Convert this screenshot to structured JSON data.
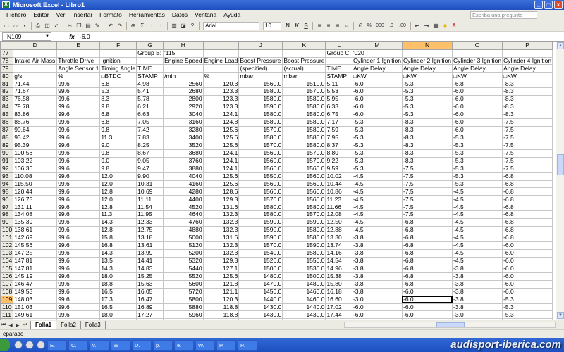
{
  "window": {
    "title": "Microsoft Excel - Libro1",
    "app_icon": "X"
  },
  "window_buttons": {
    "minimize": "_",
    "maximize": "□",
    "close": "x"
  },
  "menu": [
    "Fichero",
    "Editar",
    "Ver",
    "Insertar",
    "Formato",
    "Herramientas",
    "Datos",
    "Ventana",
    "Ayuda"
  ],
  "help_placeholder": "Escriba una pregunta",
  "toolbar": {
    "font": "Arial",
    "size": "10",
    "bold": "N",
    "italic": "K",
    "underline": "S",
    "currency": "€",
    "percent": "%",
    "thousands": "000",
    "dec_up": ",0",
    "dec_down": ",00"
  },
  "formula": {
    "cell": "N109",
    "fx": "fx",
    "value": "-6.0"
  },
  "columns": [
    "D",
    "E",
    "F",
    "G",
    "H",
    "I",
    "J",
    "K",
    "L",
    "M",
    "N",
    "O",
    "P"
  ],
  "header_rows": [
    {
      "row": "77",
      "cells": [
        "",
        "",
        "",
        "Group B:",
        "'115",
        "",
        "",
        "",
        "Group C:",
        "'020",
        "",
        "",
        ""
      ]
    },
    {
      "row": "78",
      "cells": [
        "Intake Air Mass",
        "Throttle Drive",
        "Ignition",
        "",
        "Engine Speed",
        "Engine Load",
        "Boost Pressure",
        "Boost Pressure",
        "",
        "Cylinder 1 Ignition",
        "Cylinder 2 Ignition",
        "Cylinder 3 Ignition",
        "Cylinder 4 Ignition"
      ]
    },
    {
      "row": "79",
      "cells": [
        "",
        "Angle Sensor 1",
        "Timing Angle",
        "TIME",
        "",
        "",
        "(specified)",
        "(actual)",
        "TIME",
        "Angle Delay",
        "Angle Delay",
        "Angle Delay",
        "Angle Delay"
      ]
    },
    {
      "row": "80",
      "cells": [
        "g/s",
        "%",
        "□BTDC",
        "STAMP",
        "/min",
        "%",
        "mbar",
        "mbar",
        "STAMP",
        "□KW",
        "□KW",
        "□KW",
        "□KW"
      ]
    }
  ],
  "data_rows": [
    {
      "row": "81",
      "cells": [
        "71.44",
        "99.6",
        "6.8",
        "4.98",
        "2560",
        "120.3",
        "1560.0",
        "1510.0",
        "5.11",
        "-6.0",
        "-5.3",
        "-6.8",
        "-8.3"
      ]
    },
    {
      "row": "82",
      "cells": [
        "71.67",
        "99.6",
        "5.3",
        "5.41",
        "2680",
        "123.3",
        "1580.0",
        "1570.0",
        "5.53",
        "-6.0",
        "-5.3",
        "-6.0",
        "-8.3"
      ]
    },
    {
      "row": "83",
      "cells": [
        "76.58",
        "99.6",
        "8.3",
        "5.78",
        "2800",
        "123.3",
        "1580.0",
        "1580.0",
        "5.95",
        "-6.0",
        "-5.3",
        "-6.0",
        "-8.3"
      ]
    },
    {
      "row": "84",
      "cells": [
        "79.78",
        "99.6",
        "9.8",
        "6.21",
        "2920",
        "123.3",
        "1590.0",
        "1580.0",
        "6.33",
        "-6.0",
        "-5.3",
        "-6.0",
        "-8.3"
      ]
    },
    {
      "row": "85",
      "cells": [
        "83.86",
        "99.6",
        "6.8",
        "6.63",
        "3040",
        "124.1",
        "1580.0",
        "1580.0",
        "6.75",
        "-6.0",
        "-5.3",
        "-6.0",
        "-8.3"
      ]
    },
    {
      "row": "86",
      "cells": [
        "88.76",
        "99.6",
        "6.8",
        "7.05",
        "3160",
        "124.8",
        "1580.0",
        "1580.0",
        "7.17",
        "-5.3",
        "-8.3",
        "-6.0",
        "-7.5"
      ]
    },
    {
      "row": "87",
      "cells": [
        "90.64",
        "99.6",
        "9.8",
        "7.42",
        "3280",
        "125.6",
        "1570.0",
        "1580.0",
        "7.59",
        "-5.3",
        "-8.3",
        "-6.0",
        "-7.5"
      ]
    },
    {
      "row": "88",
      "cells": [
        "93.42",
        "99.6",
        "11.3",
        "7.83",
        "3400",
        "125.6",
        "1580.0",
        "1580.0",
        "7.95",
        "-5.3",
        "-8.3",
        "-5.3",
        "-7.5"
      ]
    },
    {
      "row": "89",
      "cells": [
        "95.39",
        "99.6",
        "9.0",
        "8.25",
        "3520",
        "125.6",
        "1570.0",
        "1580.0",
        "8.37",
        "-5.3",
        "-8.3",
        "-5.3",
        "-7.5"
      ]
    },
    {
      "row": "90",
      "cells": [
        "100.56",
        "99.6",
        "9.8",
        "8.67",
        "3680",
        "124.1",
        "1560.0",
        "1570.0",
        "8.80",
        "-5.3",
        "-8.3",
        "-5.3",
        "-7.5"
      ]
    },
    {
      "row": "91",
      "cells": [
        "103.22",
        "99.6",
        "9.0",
        "9.05",
        "3760",
        "124.1",
        "1560.0",
        "1570.0",
        "9.22",
        "-5.3",
        "-8.3",
        "-5.3",
        "-7.5"
      ]
    },
    {
      "row": "92",
      "cells": [
        "106.36",
        "99.6",
        "9.8",
        "9.47",
        "3880",
        "124.1",
        "1560.0",
        "1560.0",
        "9.59",
        "-5.3",
        "-7.5",
        "-5.3",
        "-7.5"
      ]
    },
    {
      "row": "93",
      "cells": [
        "110.08",
        "99.6",
        "12.0",
        "9.90",
        "4040",
        "125.6",
        "1550.0",
        "1560.0",
        "10.02",
        "-4.5",
        "-7.5",
        "-5.3",
        "-6.8"
      ]
    },
    {
      "row": "94",
      "cells": [
        "115.50",
        "99.6",
        "12.0",
        "10.31",
        "4160",
        "125.6",
        "1560.0",
        "1560.0",
        "10.44",
        "-4.5",
        "-7.5",
        "-5.3",
        "-6.8"
      ]
    },
    {
      "row": "95",
      "cells": [
        "120.44",
        "99.6",
        "12.8",
        "10.69",
        "4280",
        "128.6",
        "1560.0",
        "1560.0",
        "10.86",
        "-4.5",
        "-7.5",
        "-4.5",
        "-6.8"
      ]
    },
    {
      "row": "96",
      "cells": [
        "126.75",
        "99.6",
        "12.0",
        "11.11",
        "4400",
        "129.3",
        "1570.0",
        "1560.0",
        "11.23",
        "-4.5",
        "-7.5",
        "-4.5",
        "-6.8"
      ]
    },
    {
      "row": "97",
      "cells": [
        "131.11",
        "99.6",
        "12.8",
        "11.54",
        "4520",
        "131.6",
        "1580.0",
        "1580.0",
        "11.66",
        "-4.5",
        "-7.5",
        "-4.5",
        "-6.8"
      ]
    },
    {
      "row": "98",
      "cells": [
        "134.08",
        "99.6",
        "11.3",
        "11.95",
        "4640",
        "132.3",
        "1580.0",
        "1570.0",
        "12.08",
        "-4.5",
        "-7.5",
        "-4.5",
        "-6.8"
      ]
    },
    {
      "row": "99",
      "cells": [
        "135.39",
        "99.6",
        "14.3",
        "12.33",
        "4760",
        "132.3",
        "1590.0",
        "1590.0",
        "12.50",
        "-4.5",
        "-6.8",
        "-4.5",
        "-6.8"
      ]
    },
    {
      "row": "100",
      "cells": [
        "138.61",
        "99.6",
        "12.8",
        "12.75",
        "4880",
        "132.3",
        "1590.0",
        "1580.0",
        "12.88",
        "-4.5",
        "-6.8",
        "-4.5",
        "-6.8"
      ]
    },
    {
      "row": "101",
      "cells": [
        "142.69",
        "99.6",
        "15.8",
        "13.18",
        "5000",
        "131.6",
        "1590.0",
        "1580.0",
        "13.30",
        "-3.8",
        "-6.8",
        "-4.5",
        "-6.8"
      ]
    },
    {
      "row": "102",
      "cells": [
        "145.56",
        "99.6",
        "16.8",
        "13.61",
        "5120",
        "132.3",
        "1570.0",
        "1590.0",
        "13.74",
        "-3.8",
        "-6.8",
        "-4.5",
        "-6.0"
      ]
    },
    {
      "row": "103",
      "cells": [
        "147.25",
        "99.6",
        "14.3",
        "13.99",
        "5200",
        "132.3",
        "1540.0",
        "1580.0",
        "14.16",
        "-3.8",
        "-6.8",
        "-4.5",
        "-6.0"
      ]
    },
    {
      "row": "104",
      "cells": [
        "147.81",
        "99.6",
        "13.5",
        "14.41",
        "5320",
        "129.3",
        "1520.0",
        "1550.0",
        "14.54",
        "-3.8",
        "-6.8",
        "-4.5",
        "-6.0"
      ]
    },
    {
      "row": "105",
      "cells": [
        "147.81",
        "99.6",
        "14.3",
        "14.83",
        "5440",
        "127.1",
        "1500.0",
        "1530.0",
        "14.96",
        "-3.8",
        "-6.8",
        "-3.8",
        "-6.0"
      ]
    },
    {
      "row": "106",
      "cells": [
        "145.19",
        "99.6",
        "18.0",
        "15.25",
        "5520",
        "125.6",
        "1480.0",
        "1500.0",
        "15.38",
        "-3.8",
        "-6.8",
        "-3.8",
        "-6.0"
      ]
    },
    {
      "row": "107",
      "cells": [
        "146.47",
        "99.6",
        "18.8",
        "15.63",
        "5600",
        "121.8",
        "1470.0",
        "1480.0",
        "15.80",
        "-3.8",
        "-6.8",
        "-3.8",
        "-6.0"
      ]
    },
    {
      "row": "108",
      "cells": [
        "149.53",
        "99.6",
        "16.5",
        "16.05",
        "5720",
        "121.1",
        "1450.0",
        "1460.0",
        "16.18",
        "-3.8",
        "-6.0",
        "-3.8",
        "-6.0"
      ]
    },
    {
      "row": "109",
      "cells": [
        "148.03",
        "99.6",
        "17.3",
        "16.47",
        "5800",
        "120.3",
        "1440.0",
        "1460.0",
        "16.60",
        "-3.0",
        "-6.0",
        "-3.8",
        "-5.3"
      ]
    },
    {
      "row": "110",
      "cells": [
        "151.03",
        "99.6",
        "16.5",
        "16.89",
        "5880",
        "118.8",
        "1430.0",
        "1440.0",
        "17.02",
        "-6.0",
        "-6.0",
        "-3.8",
        "-5.3"
      ]
    },
    {
      "row": "111",
      "cells": [
        "149.61",
        "99.6",
        "18.0",
        "17.27",
        "5960",
        "118.8",
        "1430.0",
        "1430.0",
        "17.44",
        "-6.0",
        "-6.0",
        "-3.0",
        "-5.3"
      ]
    },
    {
      "row": "112",
      "cells": [
        "151.50",
        "97.6",
        "16.5",
        "17.69",
        "6040",
        "116.5",
        "1410.0",
        "1410.0",
        "17.81",
        "-6.0",
        "-6.0",
        "-3.0",
        "-5.3"
      ]
    }
  ],
  "trailing_rows": [
    "113"
  ],
  "selected": {
    "col": "N",
    "row": "109"
  },
  "sheets": [
    "Folla1",
    "Folla2",
    "Folla3"
  ],
  "status": "eparado",
  "taskbar": [
    "E.",
    "C.",
    "v.",
    "W",
    "D.",
    "p.",
    "e.",
    "W.",
    "P.",
    "P."
  ],
  "watermark": "audisport-iberica.com"
}
